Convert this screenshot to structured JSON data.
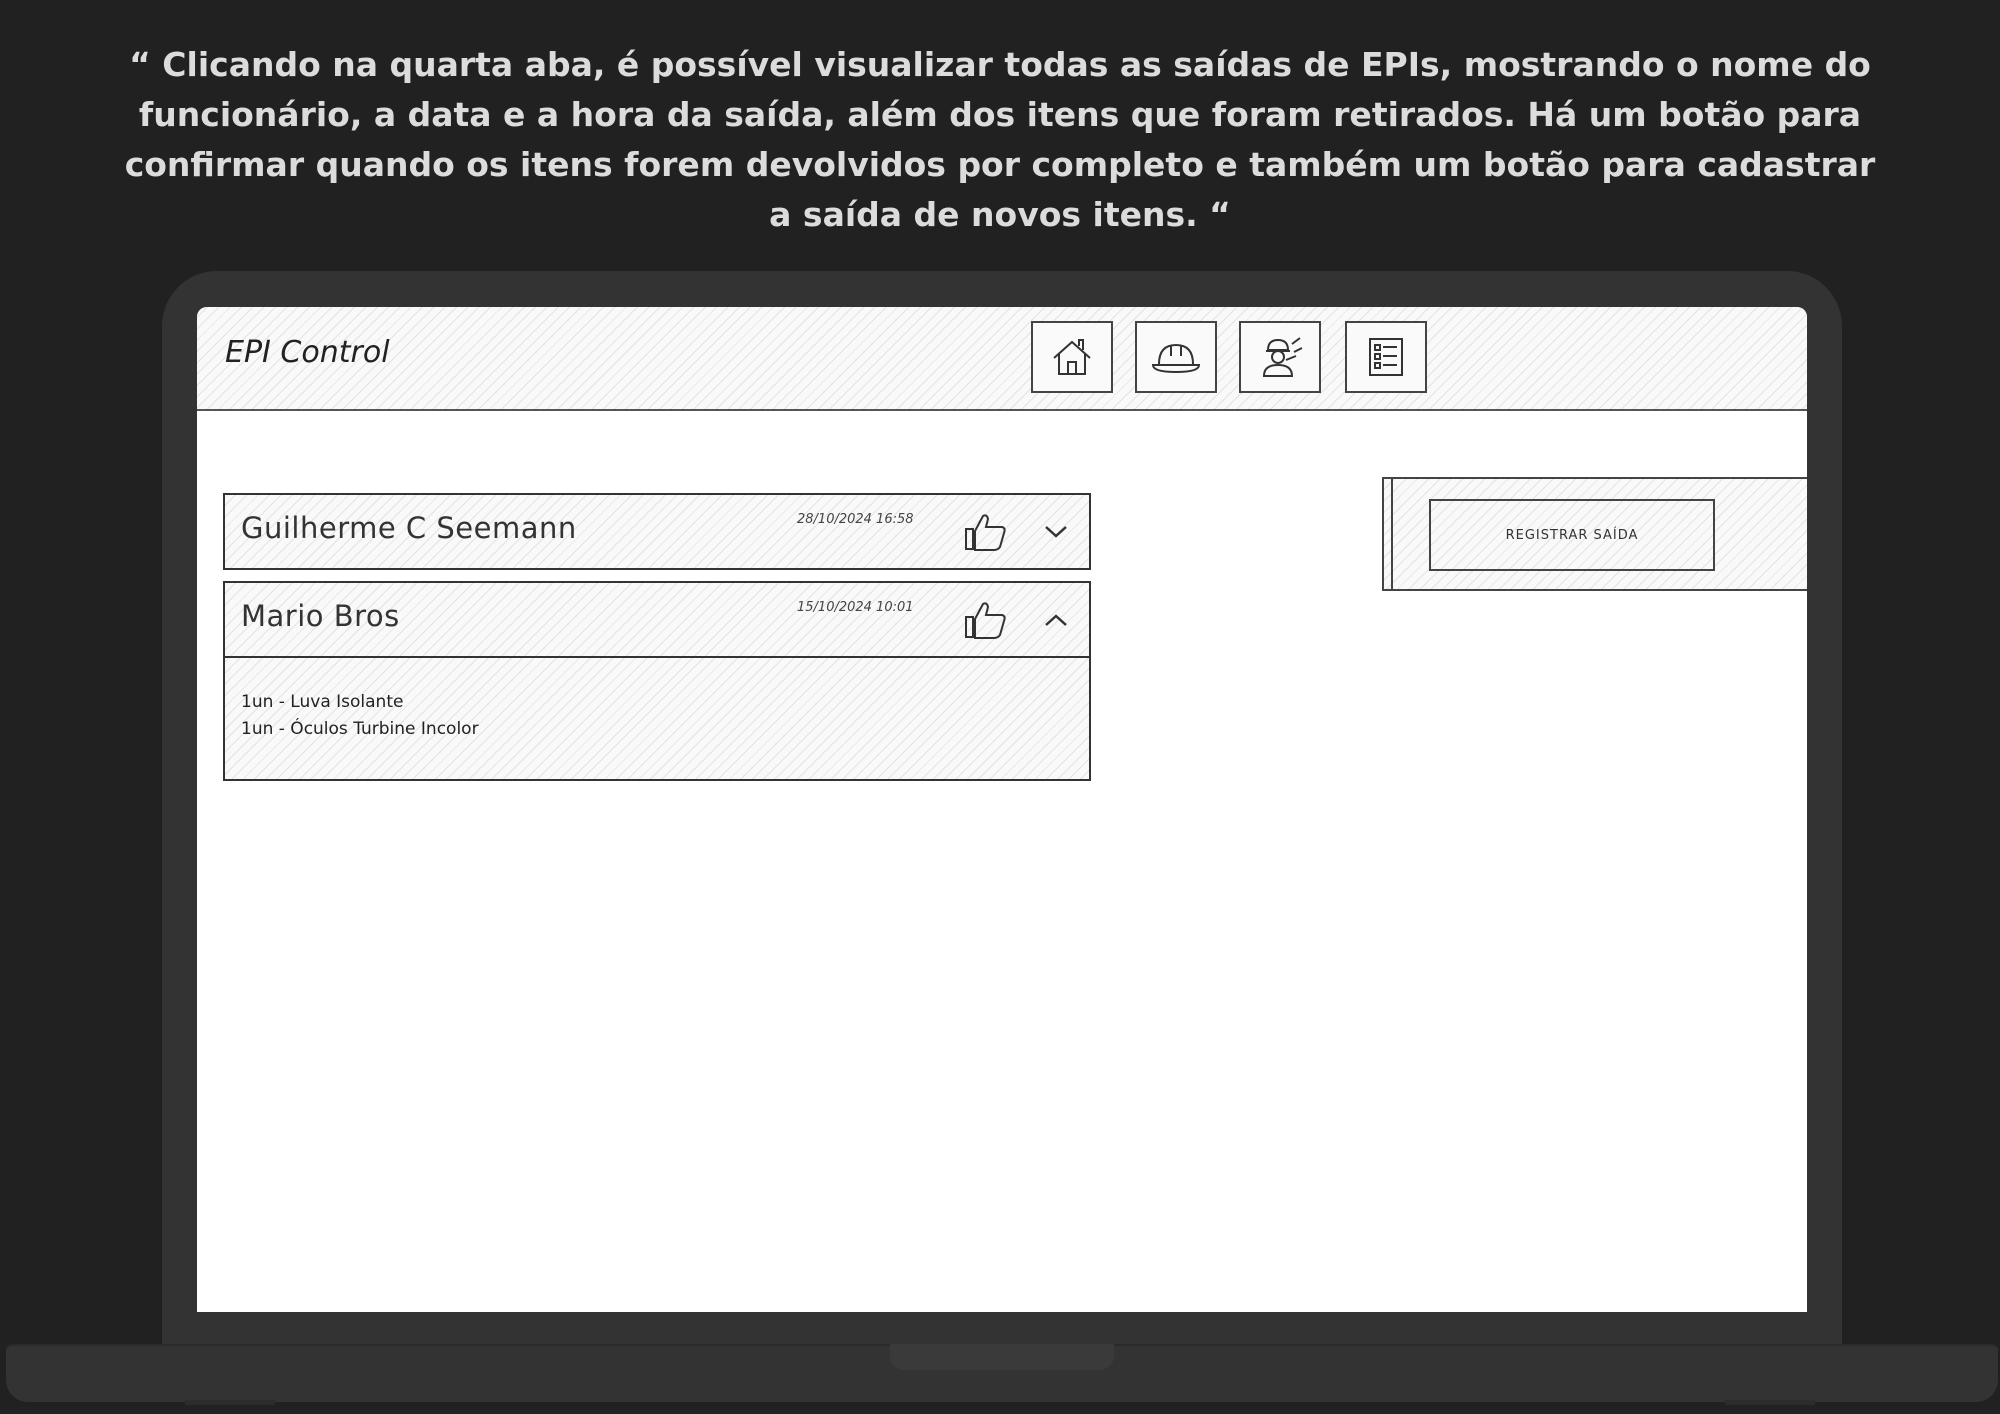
{
  "caption": "“ Clicando na quarta aba, é possível visualizar todas as saídas de EPIs, mostrando o nome do funcionário, a data e a hora da saída, além dos itens que foram retirados. Há um botão para confirmar quando os itens forem devolvidos por completo e também um botão para cadastrar a saída de novos itens. “",
  "app": {
    "brand": "EPI Control"
  },
  "nav": {
    "tabs": [
      {
        "icon": "home-icon"
      },
      {
        "icon": "helmet-icon"
      },
      {
        "icon": "worker-icon"
      },
      {
        "icon": "list-icon"
      }
    ]
  },
  "records": [
    {
      "name": "Guilherme C Seemann",
      "datetime": "28/10/2024 16:58",
      "expanded": false,
      "items": []
    },
    {
      "name": "Mario Bros",
      "datetime": "15/10/2024 10:01",
      "expanded": true,
      "items": [
        "1un - Luva Isolante",
        "1un - Óculos Turbine Incolor"
      ]
    }
  ],
  "actions": {
    "register_label": "REGISTRAR SAÍDA"
  },
  "colors": {
    "background": "#212121",
    "laptop": "#333333",
    "screen": "#ffffff",
    "caption_text": "#dcdcdc"
  }
}
